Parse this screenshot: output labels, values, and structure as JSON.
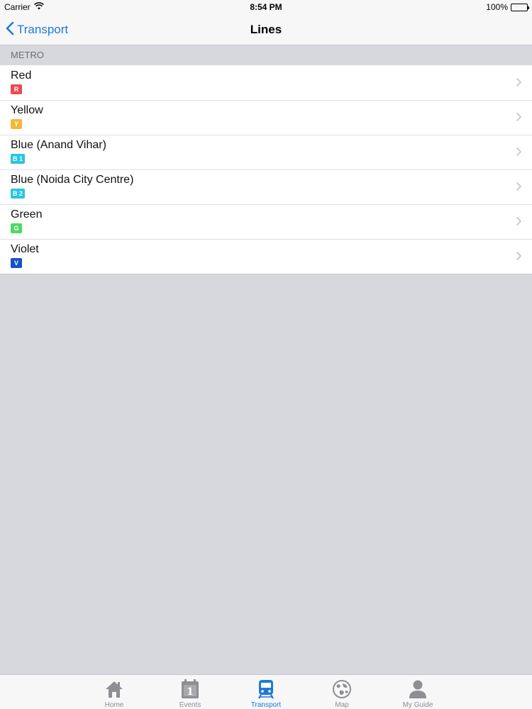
{
  "status_bar": {
    "carrier": "Carrier",
    "time": "8:54 PM",
    "battery": "100%"
  },
  "nav": {
    "back_label": "Transport",
    "title": "Lines"
  },
  "section": {
    "header": "METRO"
  },
  "lines": [
    {
      "name": "Red",
      "code": "R",
      "color": "#e84c4f"
    },
    {
      "name": "Yellow",
      "code": "Y",
      "color": "#f3b73a"
    },
    {
      "name": "Blue (Anand Vihar)",
      "code": "B 1",
      "color": "#27c5e6"
    },
    {
      "name": "Blue (Noida City Centre)",
      "code": "B 2",
      "color": "#27c5e6"
    },
    {
      "name": "Green",
      "code": "G",
      "color": "#4cd964"
    },
    {
      "name": "Violet",
      "code": "V",
      "color": "#1a4fc9"
    }
  ],
  "tabs": [
    {
      "label": "Home",
      "icon": "home-icon",
      "active": false
    },
    {
      "label": "Events",
      "icon": "calendar-icon",
      "active": false
    },
    {
      "label": "Transport",
      "icon": "train-icon",
      "active": true
    },
    {
      "label": "Map",
      "icon": "globe-icon",
      "active": false
    },
    {
      "label": "My Guide",
      "icon": "person-icon",
      "active": false
    }
  ],
  "colors": {
    "accent": "#1f7ad6",
    "inactive": "#8e8e93"
  }
}
